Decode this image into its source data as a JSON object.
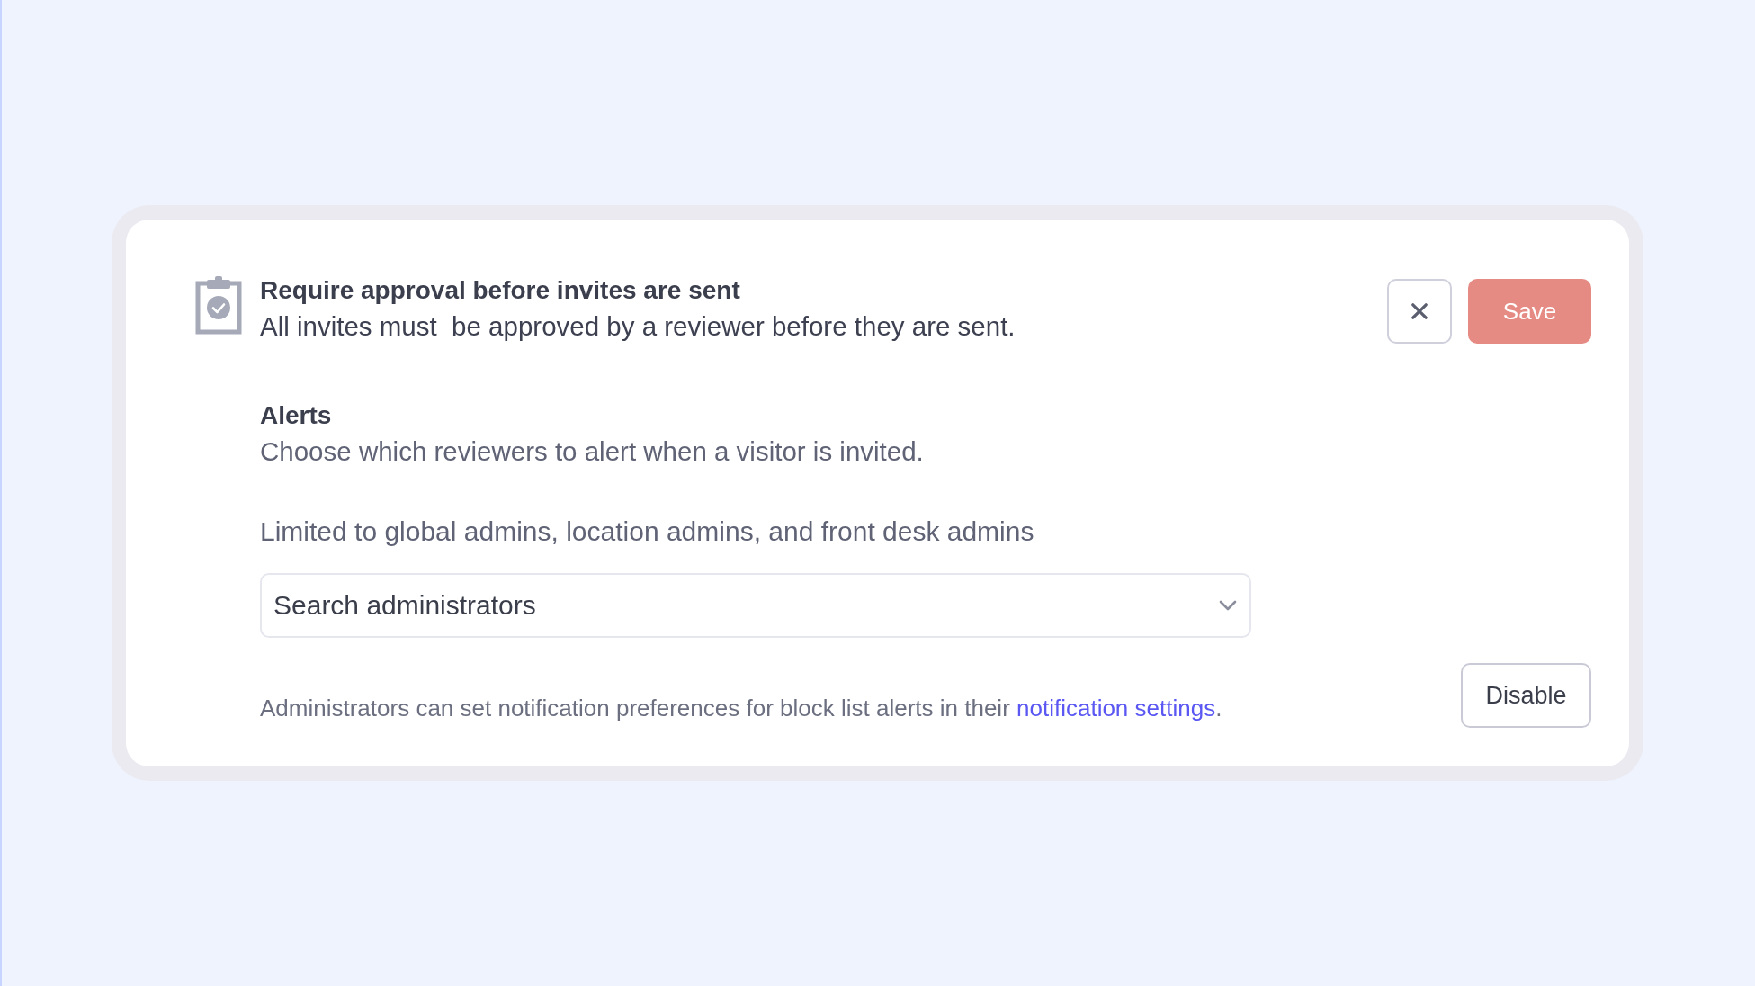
{
  "setting": {
    "title": "Require approval before invites are sent",
    "description": "All invites must  be approved by a reviewer before they are sent."
  },
  "buttons": [
    {
      "kind": "close"
    },
    {
      "kind": "save",
      "label": "Save"
    }
  ],
  "alerts": {
    "title": "Alerts",
    "description": "Choose which reviewers to alert when a visitor is invited.",
    "restriction": "Limited to global admins, location admins, and front desk admins",
    "search": {
      "placeholder": "Search administrators"
    }
  },
  "footer": {
    "note": "Administrators can set notification preferences for block list alerts in their ",
    "link": "notification settings",
    "note_end": ".",
    "button": "Disable"
  }
}
